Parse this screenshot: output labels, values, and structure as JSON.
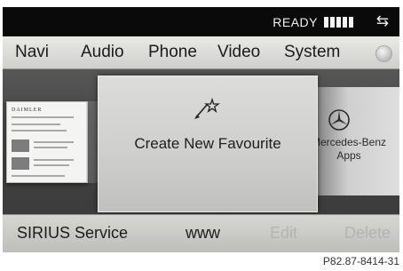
{
  "status": {
    "ready_label": "READY",
    "signal_bars": 5,
    "connection_icon": "bidirectional-arrows-icon"
  },
  "menu": {
    "items": [
      "Navi",
      "Audio",
      "Phone",
      "Video",
      "System"
    ],
    "globe_icon": "globe-icon"
  },
  "carousel": {
    "left_tile_brand": "DAIMLER",
    "center_tile_label": "Create New Favourite",
    "center_tile_icon": "favourite-star-pen-icon",
    "right_tile_label_1": "Mercedes-Benz",
    "right_tile_label_2": "Apps",
    "right_tile_icon": "mercedes-star-icon"
  },
  "bottom": {
    "items": [
      {
        "label": "SIRIUS Service",
        "enabled": true
      },
      {
        "label": "www",
        "enabled": true
      },
      {
        "label": "Edit",
        "enabled": false
      },
      {
        "label": "Delete",
        "enabled": false
      }
    ]
  },
  "reference_code": "P82.87-8414-31",
  "colors": {
    "screen_bg": "#0d0d0d",
    "menu_bg": "#dcdcd9",
    "disabled_text": "#b4b4b1"
  }
}
